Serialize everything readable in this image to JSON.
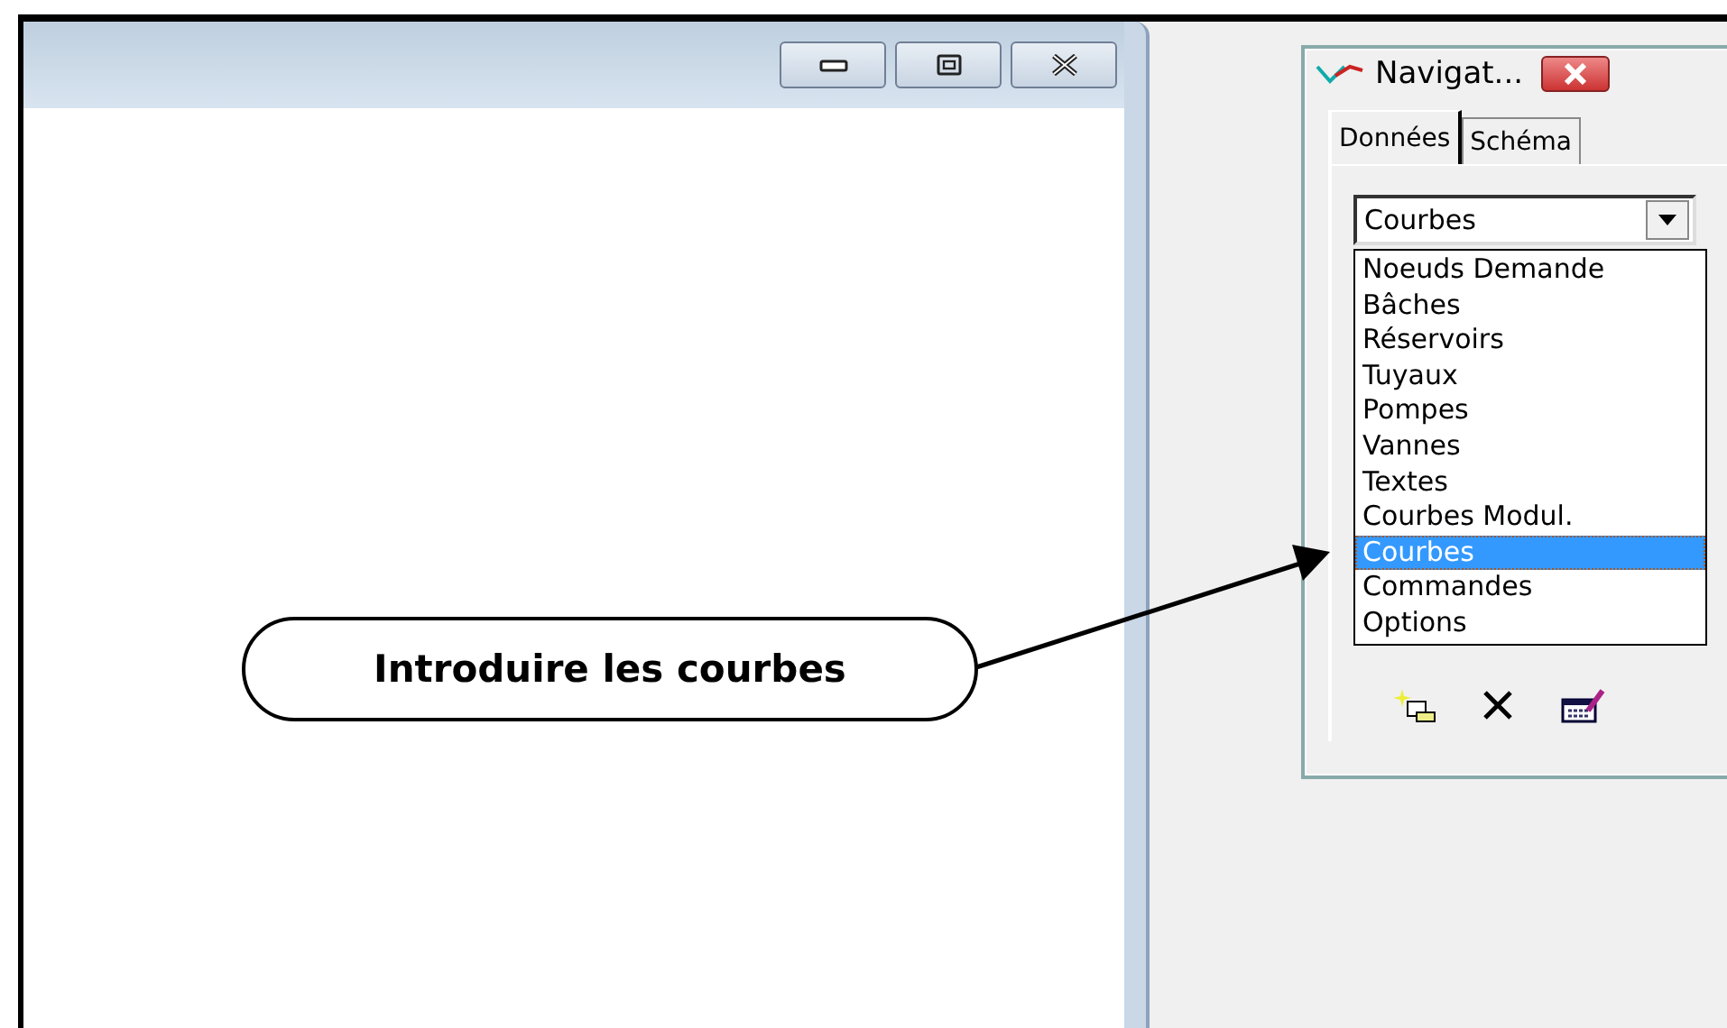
{
  "navigator": {
    "title": "Navigat...",
    "tabs": [
      {
        "label": "Données",
        "selected": true
      },
      {
        "label": "Schéma",
        "selected": false
      }
    ],
    "dropdown": {
      "value": "Courbes"
    },
    "items": [
      {
        "label": "Noeuds Demande",
        "selected": false
      },
      {
        "label": "Bâches",
        "selected": false
      },
      {
        "label": "Réservoirs",
        "selected": false
      },
      {
        "label": "Tuyaux",
        "selected": false
      },
      {
        "label": "Pompes",
        "selected": false
      },
      {
        "label": "Vannes",
        "selected": false
      },
      {
        "label": "Textes",
        "selected": false
      },
      {
        "label": "Courbes Modul.",
        "selected": false
      },
      {
        "label": "Courbes",
        "selected": true
      },
      {
        "label": "Commandes",
        "selected": false
      },
      {
        "label": "Options",
        "selected": false
      }
    ]
  },
  "callout": {
    "text": "Introduire les courbes"
  }
}
